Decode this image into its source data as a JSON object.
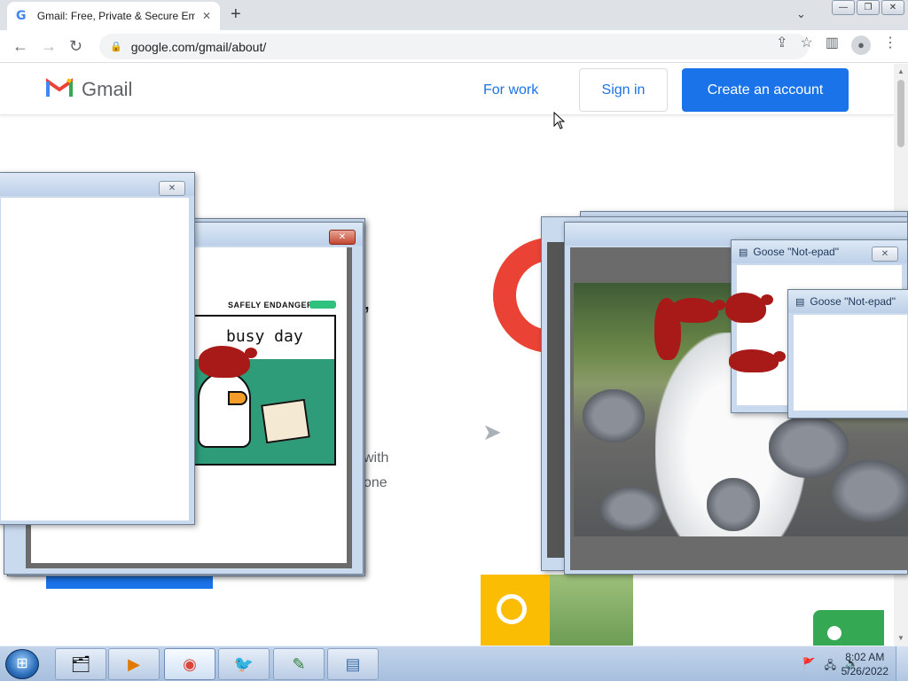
{
  "browser": {
    "tab_title": "Gmail: Free, Private & Secure Em",
    "tab_favicon": "G",
    "tab_close": "✕",
    "new_tab": "+",
    "tab_dropdown": "⌄",
    "url": "google.com/gmail/about/",
    "window_buttons": [
      "—",
      "❐",
      "✕"
    ],
    "nav": {
      "back": "←",
      "forward": "→",
      "reload": "↻"
    },
    "toolbar_icons": [
      "share-icon",
      "star-icon",
      "sidebar-icon",
      "profile-icon",
      "menu-icon"
    ]
  },
  "gmail": {
    "logo_text": "Gmail",
    "for_work": "For work",
    "sign_in": "Sign in",
    "create_account": "Create an account",
    "comma_glyph": ",",
    "hero_fragment_1": "with",
    "hero_fragment_2": "one"
  },
  "windows": {
    "blank_window_close": "✕",
    "comic_window_close": "✕",
    "comic": {
      "header": "SAFELY ENDANGERED",
      "text": "busy day"
    },
    "notepad_1_title": "Goose \"Not-epad\"",
    "notepad_2_title": "Goose \"Not-epad\"",
    "notepad_close": "✕"
  },
  "taskbar": {
    "start_label": "⊞",
    "apps": [
      {
        "name": "explorer",
        "glyph": "🗂"
      },
      {
        "name": "media-player",
        "glyph": "▶"
      },
      {
        "name": "chrome",
        "glyph": "◉"
      },
      {
        "name": "goose",
        "glyph": "🐦"
      },
      {
        "name": "notepad-chart",
        "glyph": "✎"
      },
      {
        "name": "notepad",
        "glyph": "▤"
      }
    ],
    "tray_icons": [
      "🚩",
      "🖧",
      "🔊"
    ],
    "time": "8:02 AM",
    "date": "5/26/2022"
  },
  "colors": {
    "gmail_blue": "#1a73e8",
    "gmail_red": "#ea4335",
    "goose_red": "#a81a17"
  }
}
